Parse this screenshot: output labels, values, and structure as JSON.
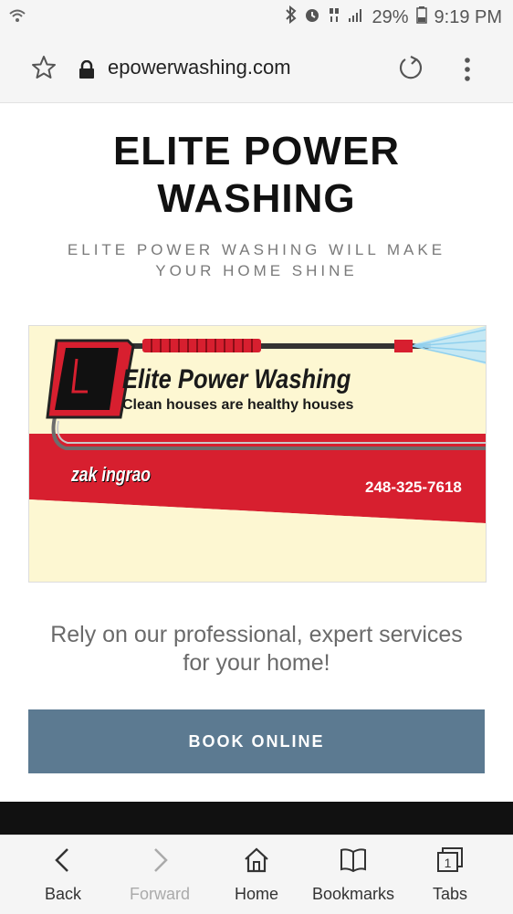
{
  "status_bar": {
    "battery_percent": "29%",
    "time": "9:19 PM"
  },
  "browser": {
    "url": "epowerwashing.com"
  },
  "page": {
    "title_line1": "ELITE POWER",
    "title_line2": "WASHING",
    "tagline_line1": "ELITE POWER WASHING WILL MAKE",
    "tagline_line2": "YOUR HOME SHINE",
    "banner": {
      "brand": "Elite Power Washing",
      "slogan": "Clean houses are healthy houses",
      "owner": "zak ingrao",
      "phone": "248-325-7618"
    },
    "lead_line1": "Rely on our professional, expert services",
    "lead_line2": "for your home!",
    "cta": "BOOK ONLINE"
  },
  "bottom_nav": {
    "back": "Back",
    "forward": "Forward",
    "home": "Home",
    "bookmarks": "Bookmarks",
    "tabs": "Tabs",
    "tab_count": "1"
  },
  "colors": {
    "cta_bg": "#5c7a91",
    "banner_red": "#d71f2f",
    "banner_cream": "#fdf7d2"
  }
}
